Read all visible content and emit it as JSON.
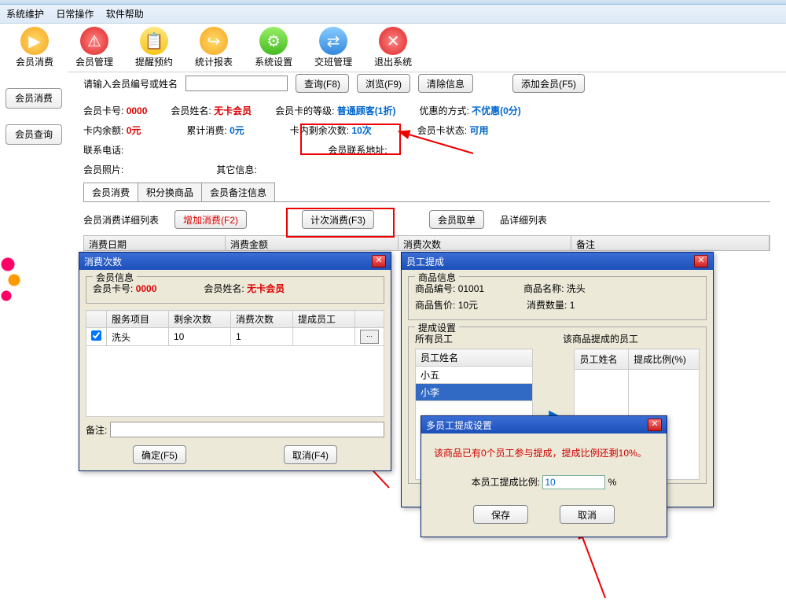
{
  "menu": {
    "sys": "系统维护",
    "daily": "日常操作",
    "help": "软件帮助"
  },
  "toolbar": {
    "consume": "会员消费",
    "manage": "会员管理",
    "remind": "提醒预约",
    "stats": "统计报表",
    "settings": "系统设置",
    "shift": "交班管理",
    "exit": "退出系统"
  },
  "sidebar": {
    "consume": "会员消费",
    "query": "会员查询"
  },
  "search": {
    "placeholder": "请输入会员编号或姓名",
    "query": "查询(F8)",
    "browse": "浏览(F9)",
    "clear": "清除信息",
    "add": "添加会员(F5)"
  },
  "info": {
    "card_no_lbl": "会员卡号:",
    "card_no": "0000",
    "name_lbl": "会员姓名:",
    "name": "无卡会员",
    "level_lbl": "会员卡的等级:",
    "level": "普通顾客(1折)",
    "discount_lbl": "优惠的方式:",
    "discount": "不优惠(0分)",
    "balance_lbl": "卡内余额:",
    "balance": "0元",
    "total_lbl": "累计消费:",
    "total": "0元",
    "remain_lbl": "卡内剩余次数:",
    "remain": "10次",
    "status_lbl": "会员卡状态:",
    "status": "可用",
    "phone_lbl": "联系电话:",
    "addr_lbl": "会员联系地址:",
    "photo_lbl": "会员照片:",
    "other_lbl": "其它信息:"
  },
  "tabs": {
    "t1": "会员消费",
    "t2": "积分换商品",
    "t3": "会员备注信息"
  },
  "actions": {
    "detail_lbl": "会员消费详细列表",
    "add": "增加消费(F2)",
    "count": "计次消费(F3)",
    "order": "会员取单",
    "prod_detail": "品详细列表"
  },
  "grid": {
    "date": "消费日期",
    "amount": "消费金额",
    "times": "消费次数",
    "remark": "备注"
  },
  "dlg1": {
    "title": "消费次数",
    "member_info": "会员信息",
    "card_no_lbl": "会员卡号:",
    "card_no": "0000",
    "name_lbl": "会员姓名:",
    "name": "无卡会员",
    "col_service": "服务项目",
    "col_remain": "剩余次数",
    "col_consume": "消费次数",
    "col_staff": "提成员工",
    "row_service": "洗头",
    "row_remain": "10",
    "row_consume": "1",
    "remark_lbl": "备注:",
    "ok": "确定(F5)",
    "cancel": "取消(F4)"
  },
  "dlg2": {
    "title": "员工提成",
    "prod_info": "商品信息",
    "prod_no_lbl": "商品编号:",
    "prod_no": "01001",
    "prod_name_lbl": "商品名称:",
    "prod_name": "洗头",
    "price_lbl": "商品售价:",
    "price": "10元",
    "qty_lbl": "消费数量:",
    "qty": "1",
    "commission_title": "提成设置",
    "all_staff": "所有员工",
    "assigned_staff": "该商品提成的员工",
    "col_name": "员工姓名",
    "col_name2": "员工姓名",
    "col_rate": "提成比例(%)",
    "staff1": "小五",
    "staff2": "小李"
  },
  "dlg3": {
    "title": "多员工提成设置",
    "msg": "该商品已有0个员工参与提成，提成比例还剩10%。",
    "rate_lbl": "本员工提成比例:",
    "rate_val": "10",
    "pct": "%",
    "save": "保存",
    "cancel": "取消"
  }
}
